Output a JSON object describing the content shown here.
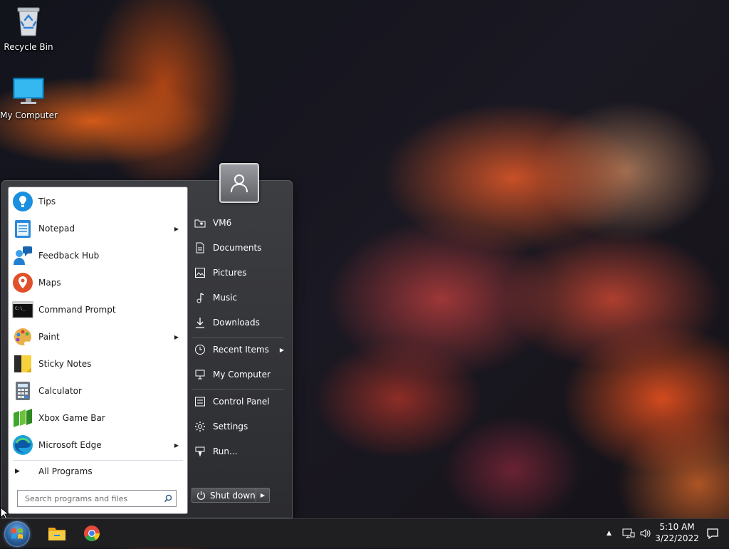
{
  "desktop": {
    "icons": [
      {
        "label": "Recycle Bin",
        "icon": "recycle-bin-icon"
      },
      {
        "label": "My Computer",
        "icon": "monitor-icon"
      }
    ]
  },
  "start_menu": {
    "user_icon": "user-icon",
    "programs": [
      {
        "label": "Tips",
        "icon": "tips-icon",
        "submenu": false
      },
      {
        "label": "Notepad",
        "icon": "notepad-icon",
        "submenu": true
      },
      {
        "label": "Feedback Hub",
        "icon": "feedback-hub-icon",
        "submenu": false
      },
      {
        "label": "Maps",
        "icon": "maps-icon",
        "submenu": false
      },
      {
        "label": "Command Prompt",
        "icon": "command-prompt-icon",
        "submenu": false
      },
      {
        "label": "Paint",
        "icon": "paint-icon",
        "submenu": true
      },
      {
        "label": "Sticky Notes",
        "icon": "sticky-notes-icon",
        "submenu": false
      },
      {
        "label": "Calculator",
        "icon": "calculator-icon",
        "submenu": false
      },
      {
        "label": "Xbox Game Bar",
        "icon": "xbox-game-bar-icon",
        "submenu": false
      },
      {
        "label": "Microsoft Edge",
        "icon": "edge-icon",
        "submenu": true
      }
    ],
    "all_programs": "All Programs",
    "search_placeholder": "Search programs and files",
    "right_items": [
      {
        "label": "VM6",
        "icon": "user-folder-icon"
      },
      {
        "label": "Documents",
        "icon": "document-icon"
      },
      {
        "label": "Pictures",
        "icon": "picture-icon"
      },
      {
        "label": "Music",
        "icon": "music-note-icon"
      },
      {
        "label": "Downloads",
        "icon": "download-icon"
      },
      {
        "label": "Recent Items",
        "icon": "clock-icon",
        "submenu": true
      },
      {
        "label": "My Computer",
        "icon": "computer-icon"
      },
      {
        "label": "Control Panel",
        "icon": "control-panel-icon"
      },
      {
        "label": "Settings",
        "icon": "gear-icon"
      },
      {
        "label": "Run...",
        "icon": "run-icon"
      }
    ],
    "shutdown_label": "Shut down"
  },
  "taskbar": {
    "pinned": [
      "start-orb-icon",
      "file-explorer-icon",
      "chrome-icon"
    ],
    "tray": [
      "chevron-up-icon",
      "network-icon",
      "volume-icon"
    ],
    "time": "5:10 AM",
    "date": "3/22/2022",
    "notification_icon": "notification-icon"
  }
}
